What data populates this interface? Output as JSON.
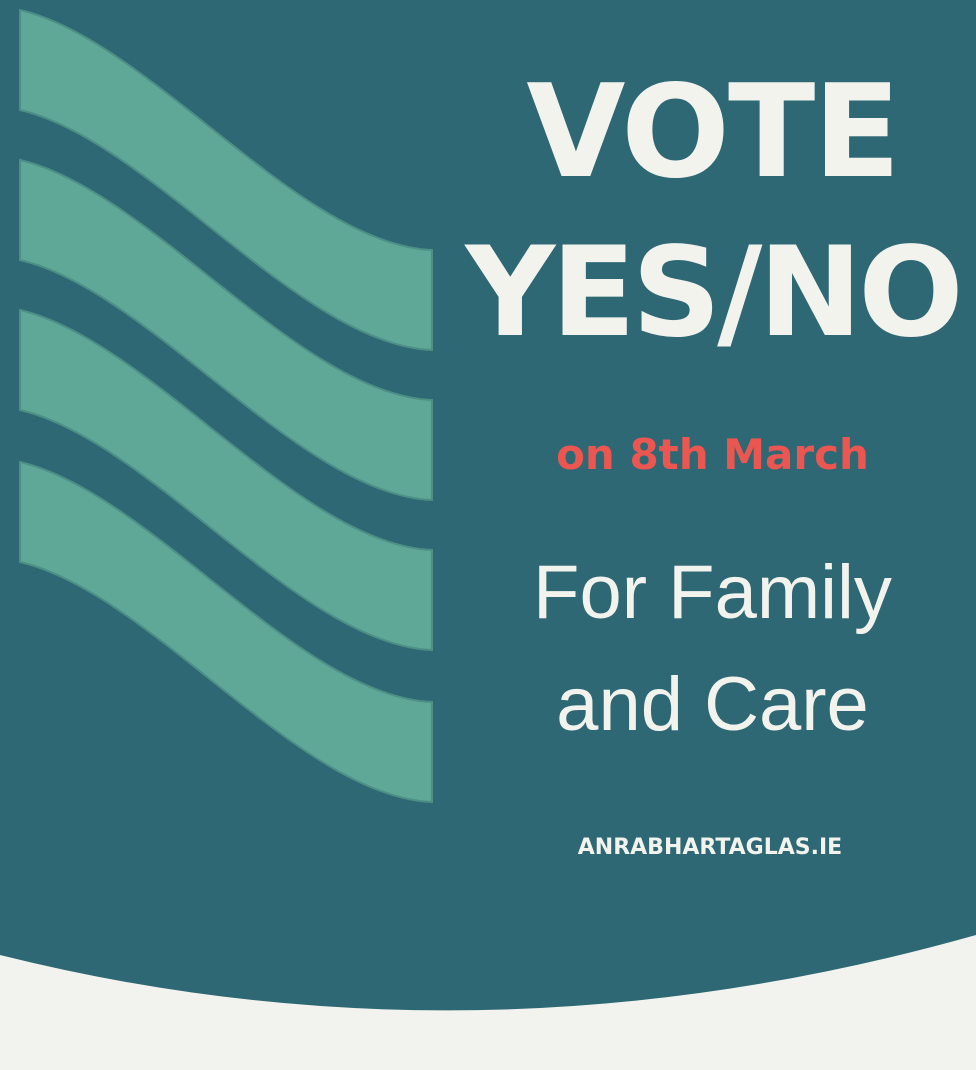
{
  "poster": {
    "headline_line1": "VOTE",
    "headline_line2": "YES/NO",
    "date": "on 8th March",
    "tagline_line1": "For Family",
    "tagline_line2": "and Care",
    "website": "ANRABHARTAGLAS.IE"
  },
  "colors": {
    "background": "#2e6874",
    "stripes": "#5fa898",
    "accent": "#ec5651",
    "text": "#f3f3ee",
    "footer": "#f2f3ee"
  }
}
